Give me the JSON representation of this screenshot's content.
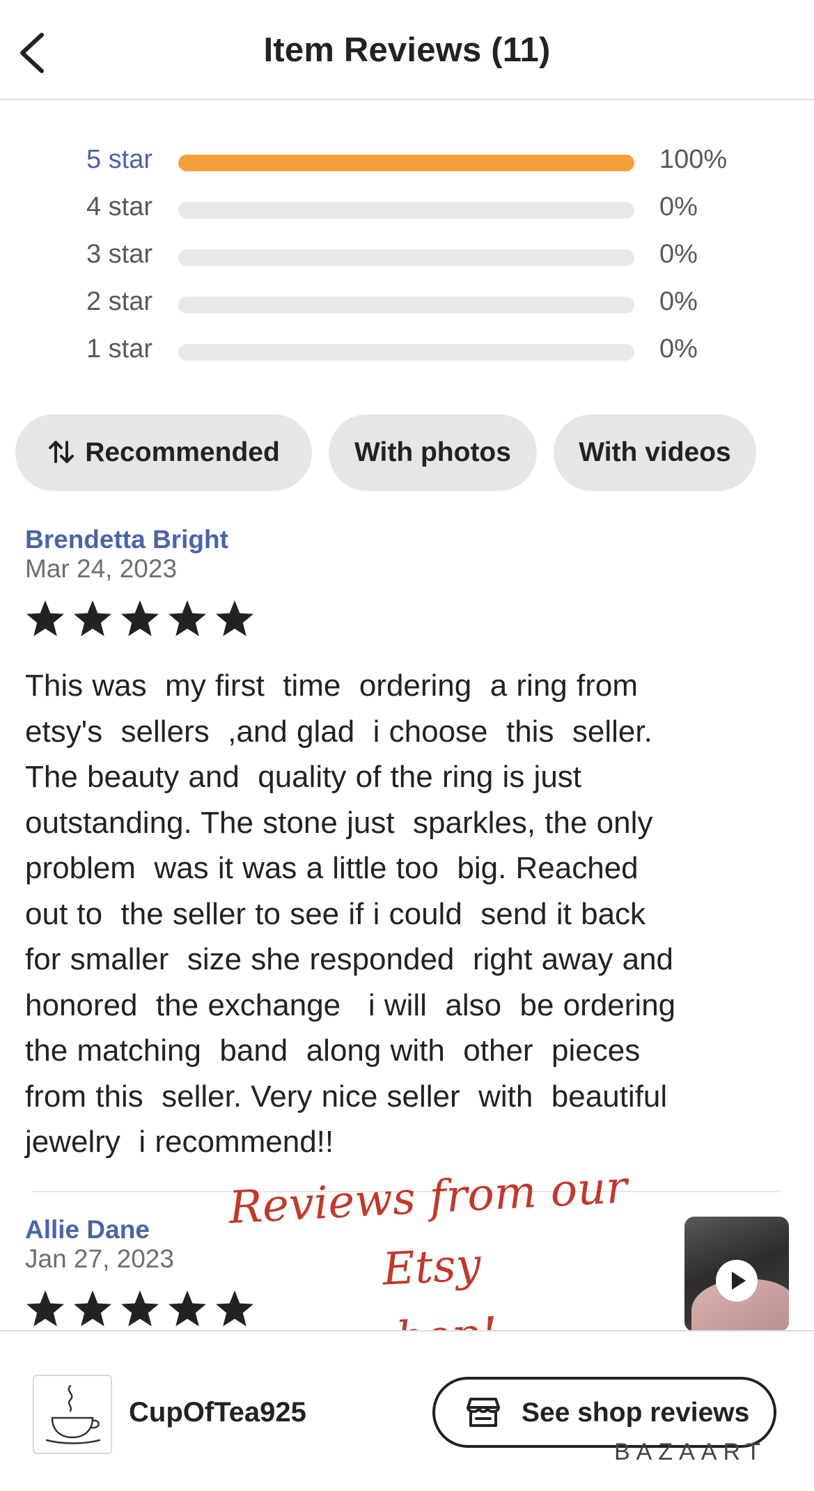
{
  "header": {
    "title": "Item Reviews (11)",
    "back_icon": "chevron-left-icon"
  },
  "rating_distribution": [
    {
      "label": "5 star",
      "percent_text": "100%",
      "fraction": 1.0
    },
    {
      "label": "4 star",
      "percent_text": "0%",
      "fraction": 0
    },
    {
      "label": "3 star",
      "percent_text": "0%",
      "fraction": 0
    },
    {
      "label": "2 star",
      "percent_text": "0%",
      "fraction": 0
    },
    {
      "label": "1 star",
      "percent_text": "0%",
      "fraction": 0
    }
  ],
  "filters": {
    "sort_label": "Recommended",
    "photos_label": "With photos",
    "videos_label": "With videos"
  },
  "reviews": [
    {
      "name": "Brendetta Bright",
      "date": "Mar 24, 2023",
      "rating": 5,
      "text": "This was  my first  time  ordering  a ring from\netsy's  sellers  ,and glad  i choose  this  seller.\nThe beauty and  quality of the ring is just\noutstanding. The stone just  sparkles, the only\nproblem  was it was a little too  big. Reached\nout to  the seller to see if i could  send it back\nfor smaller  size she responded  right away and\nhonored  the exchange   i will  also  be ordering\nthe matching  band  along with  other  pieces\nfrom this  seller. Very nice seller  with  beautiful\njewelry  i recommend!!"
    },
    {
      "name": "Allie Dane",
      "date": "Jan 27, 2023",
      "rating": 5
    }
  ],
  "overlay": {
    "line1": "Reviews from our Etsy",
    "line2": "shop!"
  },
  "bottom_bar": {
    "shop_name": "CupOfTea925",
    "see_reviews_label": "See shop reviews",
    "watermark": "BAZAART"
  },
  "colors": {
    "accent_blue": "#4b64a6",
    "bar_orange": "#f4a03a",
    "overlay_red": "#c0392b"
  }
}
